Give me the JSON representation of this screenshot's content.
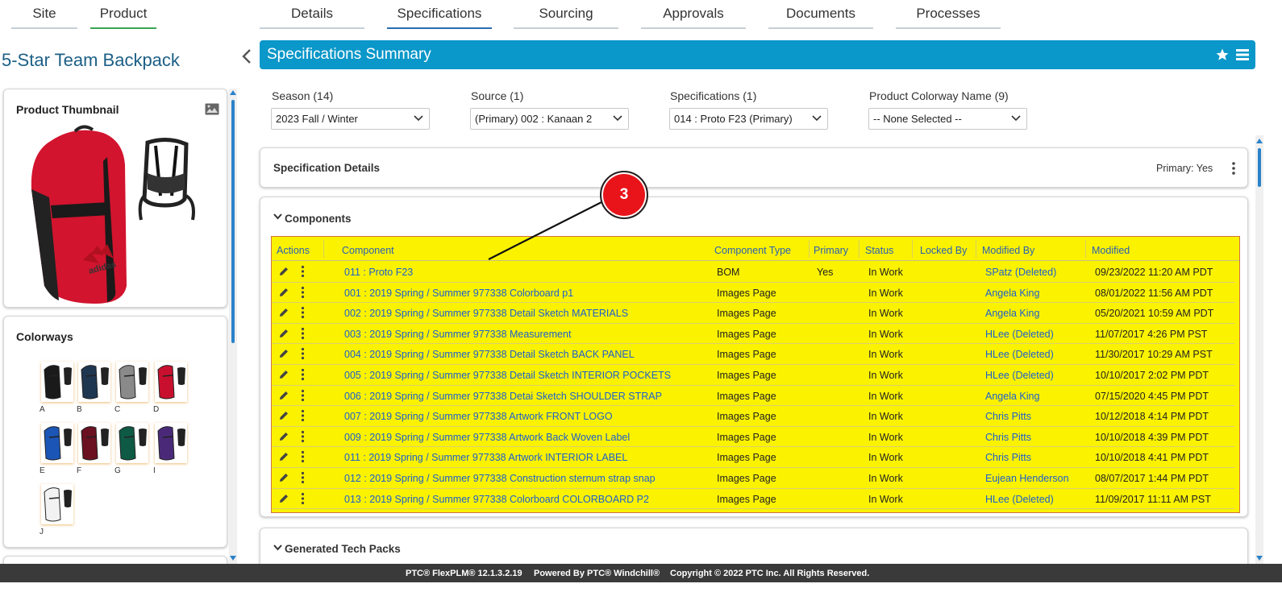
{
  "top_nav": {
    "left": [
      {
        "label": "Site"
      },
      {
        "label": "Product"
      }
    ],
    "right": [
      {
        "label": "Details"
      },
      {
        "label": "Specifications"
      },
      {
        "label": "Sourcing"
      },
      {
        "label": "Approvals"
      },
      {
        "label": "Documents"
      },
      {
        "label": "Processes"
      }
    ]
  },
  "product": {
    "title": "5-Star Team Backpack",
    "thumbnail_title": "Product Thumbnail",
    "colorways_title": "Colorways",
    "colorways": [
      {
        "label": "A",
        "color": "#1a1a1a"
      },
      {
        "label": "B",
        "color": "#1f3650"
      },
      {
        "label": "C",
        "color": "#8a8a8a"
      },
      {
        "label": "D",
        "color": "#c8102e"
      },
      {
        "label": "E",
        "color": "#1b55b5"
      },
      {
        "label": "F",
        "color": "#6a1020"
      },
      {
        "label": "G",
        "color": "#0f5a45"
      },
      {
        "label": "I",
        "color": "#4a2a78"
      },
      {
        "label": "J",
        "color": "#f2f2f2"
      }
    ]
  },
  "summary": {
    "title": "Specifications Summary"
  },
  "filters": [
    {
      "label": "Season (14)",
      "value": "2023 Fall / Winter"
    },
    {
      "label": "Source (1)",
      "value": "(Primary) 002 : Kanaan 2"
    },
    {
      "label": "Specifications (1)",
      "value": "014 : Proto F23 (Primary)"
    },
    {
      "label": "Product Colorway Name (9)",
      "value": "-- None Selected --"
    }
  ],
  "spec_details": {
    "title": "Specification Details",
    "primary": "Primary: Yes"
  },
  "components": {
    "title": "Components",
    "columns": [
      "Actions",
      "Component",
      "Component Type",
      "Primary",
      "Status",
      "Locked By",
      "Modified By",
      "Modified"
    ],
    "rows": [
      {
        "component": "011 : Proto F23",
        "type": "BOM",
        "primary": "Yes",
        "status": "In Work",
        "locked": "",
        "modified_by": "SPatz (Deleted)",
        "modified": "09/23/2022 11:20 AM PDT"
      },
      {
        "component": "001 : 2019 Spring / Summer  977338 Colorboard p1",
        "type": "Images Page",
        "primary": "",
        "status": "In Work",
        "locked": "",
        "modified_by": "Angela King",
        "modified": "08/01/2022 11:56 AM PDT"
      },
      {
        "component": "002 : 2019 Spring / Summer  977338 Detail Sketch MATERIALS",
        "type": "Images Page",
        "primary": "",
        "status": "In Work",
        "locked": "",
        "modified_by": "Angela King",
        "modified": "05/20/2021 10:59 AM PDT"
      },
      {
        "component": "003 : 2019 Spring / Summer  977338 Measurement",
        "type": "Images Page",
        "primary": "",
        "status": "In Work",
        "locked": "",
        "modified_by": "HLee (Deleted)",
        "modified": "11/07/2017 4:26 PM PST"
      },
      {
        "component": "004 : 2019 Spring / Summer  977338 Detail Sketch BACK PANEL",
        "type": "Images Page",
        "primary": "",
        "status": "In Work",
        "locked": "",
        "modified_by": "HLee (Deleted)",
        "modified": "11/30/2017 10:29 AM PST"
      },
      {
        "component": "005 : 2019 Spring / Summer  977338 Detail Sketch INTERIOR POCKETS",
        "type": "Images Page",
        "primary": "",
        "status": "In Work",
        "locked": "",
        "modified_by": "HLee (Deleted)",
        "modified": "10/10/2017 2:02 PM PDT"
      },
      {
        "component": "006 : 2019 Spring / Summer  977338 Detai  Sketch SHOULDER STRAP",
        "type": "Images Page",
        "primary": "",
        "status": "In Work",
        "locked": "",
        "modified_by": "Angela King",
        "modified": "07/15/2020 4:45 PM PDT"
      },
      {
        "component": "007 : 2019 Spring / Summer  977338 Artwork FRONT LOGO",
        "type": "Images Page",
        "primary": "",
        "status": "In Work",
        "locked": "",
        "modified_by": "Chris Pitts",
        "modified": "10/12/2018 4:14 PM PDT"
      },
      {
        "component": "009 : 2019 Spring / Summer  977338 Artwork Back Woven Label",
        "type": "Images Page",
        "primary": "",
        "status": "In Work",
        "locked": "",
        "modified_by": "Chris Pitts",
        "modified": "10/10/2018 4:39 PM PDT"
      },
      {
        "component": "011 : 2019 Spring / Summer  977338 Artwork INTERIOR LABEL",
        "type": "Images Page",
        "primary": "",
        "status": "In Work",
        "locked": "",
        "modified_by": "Chris Pitts",
        "modified": "10/10/2018 4:41 PM PDT"
      },
      {
        "component": "012 : 2019 Spring / Summer  977338 Construction sternum strap snap",
        "type": "Images Page",
        "primary": "",
        "status": "In Work",
        "locked": "",
        "modified_by": "Eujean Henderson",
        "modified": "08/07/2017 1:44 PM PDT"
      },
      {
        "component": "013 : 2019 Spring / Summer  977338 Colorboard COLORBOARD P2",
        "type": "Images Page",
        "primary": "",
        "status": "In Work",
        "locked": "",
        "modified_by": "HLee (Deleted)",
        "modified": "11/09/2017 11:11 AM PST"
      }
    ]
  },
  "generated_tech_packs": {
    "title": "Generated Tech Packs"
  },
  "annotation": {
    "number": "3"
  },
  "footer": {
    "version": "PTC® FlexPLM® 12.1.3.2.19",
    "powered": "Powered By PTC® Windchill®",
    "copyright": "Copyright © 2022 PTC Inc. All Rights Reserved."
  },
  "colors": {
    "accent": "#0a97c9",
    "highlight": "#fbf200",
    "link": "#1c5fd0"
  }
}
